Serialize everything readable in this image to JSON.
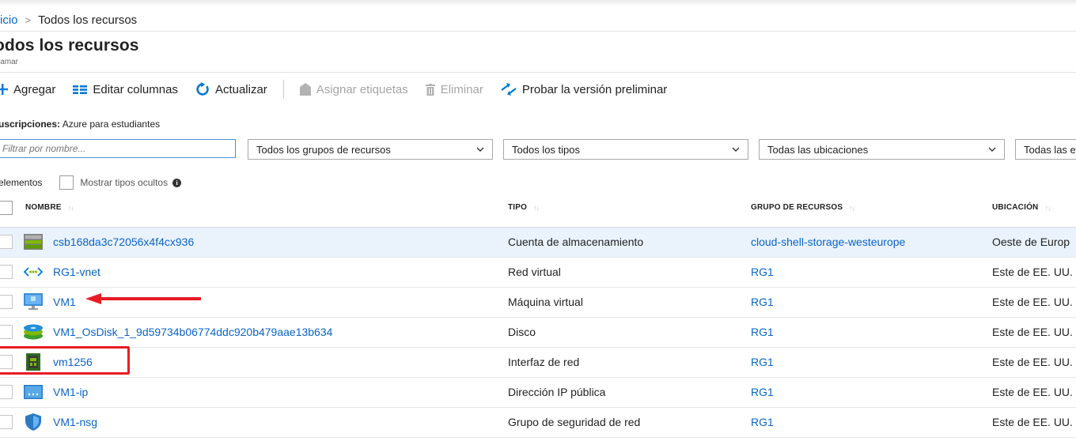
{
  "breadcrumb": {
    "home": "icio",
    "current": "Todos los recursos"
  },
  "page": {
    "title": "odos los recursos",
    "subtitle": "jamar"
  },
  "toolbar": {
    "add": "Agregar",
    "edit_columns": "Editar columnas",
    "refresh": "Actualizar",
    "assign_tags": "Asignar etiquetas",
    "delete": "Eliminar",
    "try_preview": "Probar la versión preliminar"
  },
  "subscriptions": {
    "label": "uscripciones:",
    "value": "Azure para estudiantes"
  },
  "filters": {
    "name_placeholder": "Filtrar por nombre...",
    "groups": "Todos los grupos de recursos",
    "types": "Todos los tipos",
    "locations": "Todas las ubicaciones",
    "tags": "Todas las e"
  },
  "counts": {
    "items": "elementos",
    "show_hidden": "Mostrar tipos ocultos"
  },
  "table": {
    "columns": {
      "name": "NOMBRE",
      "type": "TIPO",
      "group": "GRUPO DE RECURSOS",
      "location": "UBICACIÓN"
    },
    "rows": [
      {
        "icon": "storage-account-icon",
        "name": "csb168da3c72056x4f4cx936",
        "type": "Cuenta de almacenamiento",
        "group": "cloud-shell-storage-westeurope",
        "location": "Oeste de Europ",
        "selected": true
      },
      {
        "icon": "virtual-network-icon",
        "name": "RG1-vnet",
        "type": "Red virtual",
        "group": "RG1",
        "location": "Este de EE. UU."
      },
      {
        "icon": "virtual-machine-icon",
        "name": "VM1",
        "type": "Máquina virtual",
        "group": "RG1",
        "location": "Este de EE. UU."
      },
      {
        "icon": "disk-icon",
        "name": "VM1_OsDisk_1_9d59734b06774ddc920b479aae13b634",
        "type": "Disco",
        "group": "RG1",
        "location": "Este de EE. UU."
      },
      {
        "icon": "network-interface-icon",
        "name": "vm1256",
        "type": "Interfaz de red",
        "group": "RG1",
        "location": "Este de EE. UU."
      },
      {
        "icon": "public-ip-icon",
        "name": "VM1-ip",
        "type": "Dirección IP pública",
        "group": "RG1",
        "location": "Este de EE. UU."
      },
      {
        "icon": "network-security-group-icon",
        "name": "VM1-nsg",
        "type": "Grupo de seguridad de red",
        "group": "RG1",
        "location": "Este de EE. UU."
      }
    ]
  },
  "colors": {
    "link": "#0a64c8",
    "accent": "#0078d4",
    "annotation": "#e81c24",
    "selected_row": "#eaf3fc"
  }
}
